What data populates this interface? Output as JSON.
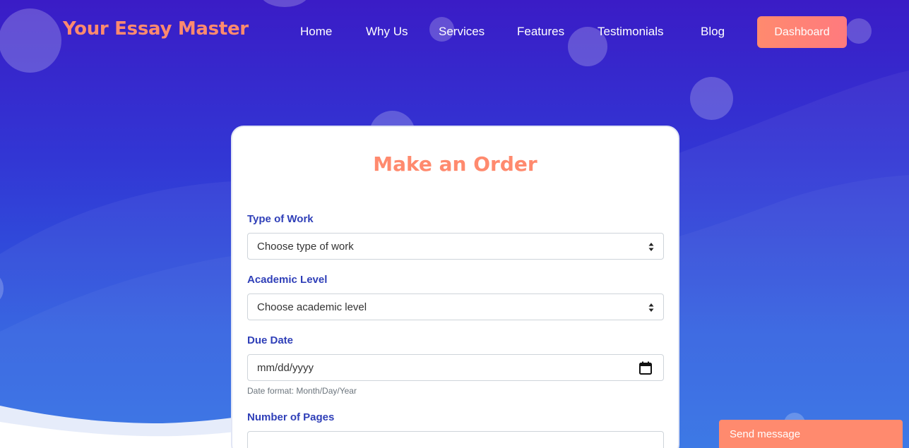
{
  "header": {
    "brand": "Your Essay Master",
    "nav": [
      {
        "label": "Home"
      },
      {
        "label": "Why Us"
      },
      {
        "label": "Services"
      },
      {
        "label": "Features"
      },
      {
        "label": "Testimonials"
      },
      {
        "label": "Blog"
      }
    ],
    "dashboard_label": "Dashboard"
  },
  "order_form": {
    "title": "Make an Order",
    "type_of_work": {
      "label": "Type of Work",
      "value": "Choose type of work"
    },
    "academic_level": {
      "label": "Academic Level",
      "value": "Choose academic level"
    },
    "due_date": {
      "label": "Due Date",
      "placeholder": "mm/dd/yyyy",
      "hint": "Date format: Month/Day/Year"
    },
    "number_of_pages": {
      "label": "Number of Pages",
      "value": ""
    }
  },
  "chat_widget": {
    "label": "Send message"
  },
  "colors": {
    "accent": "#ff8a6e",
    "label_blue": "#2f3fb8",
    "bg_top": "#3a1cc6",
    "bg_bottom": "#2c6de3"
  },
  "icons": {
    "select_arrow": "select-arrows-icon",
    "calendar": "calendar-icon"
  }
}
